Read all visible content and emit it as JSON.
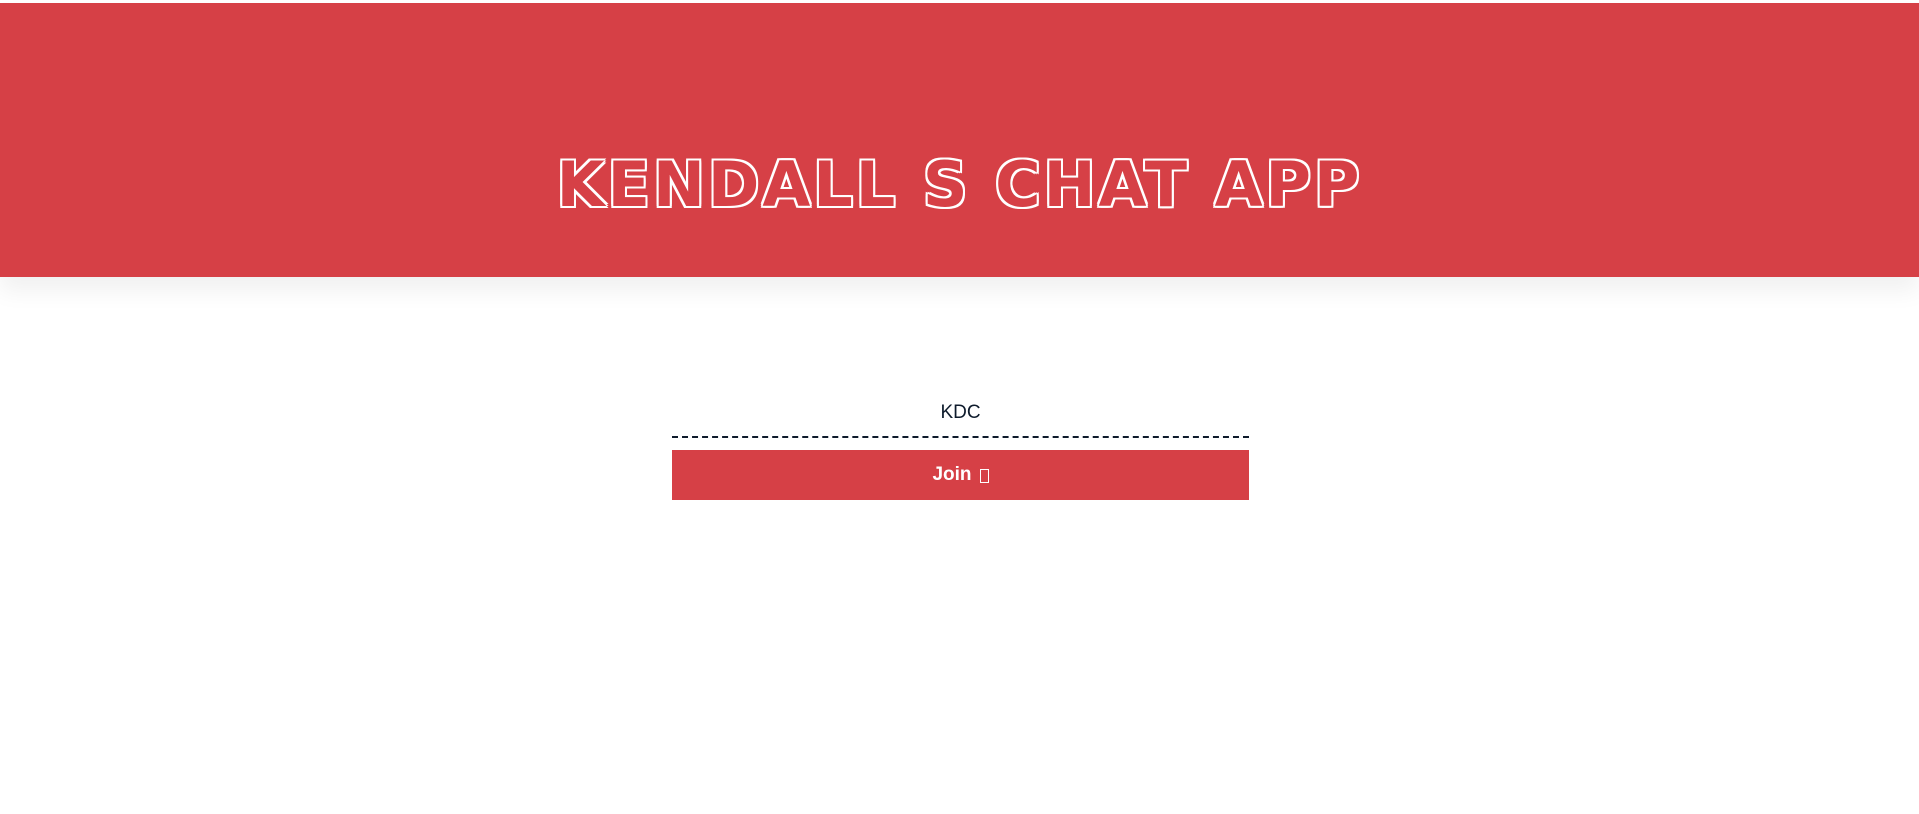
{
  "header": {
    "title": "KENDALL S CHAT APP"
  },
  "join_form": {
    "name_input_value": "KDC",
    "join_button_label": "Join",
    "join_button_icon": "missing-glyph-icon"
  },
  "colors": {
    "accent": "#d64046",
    "text_dark": "#0e1b2c",
    "background": "#ffffff"
  }
}
